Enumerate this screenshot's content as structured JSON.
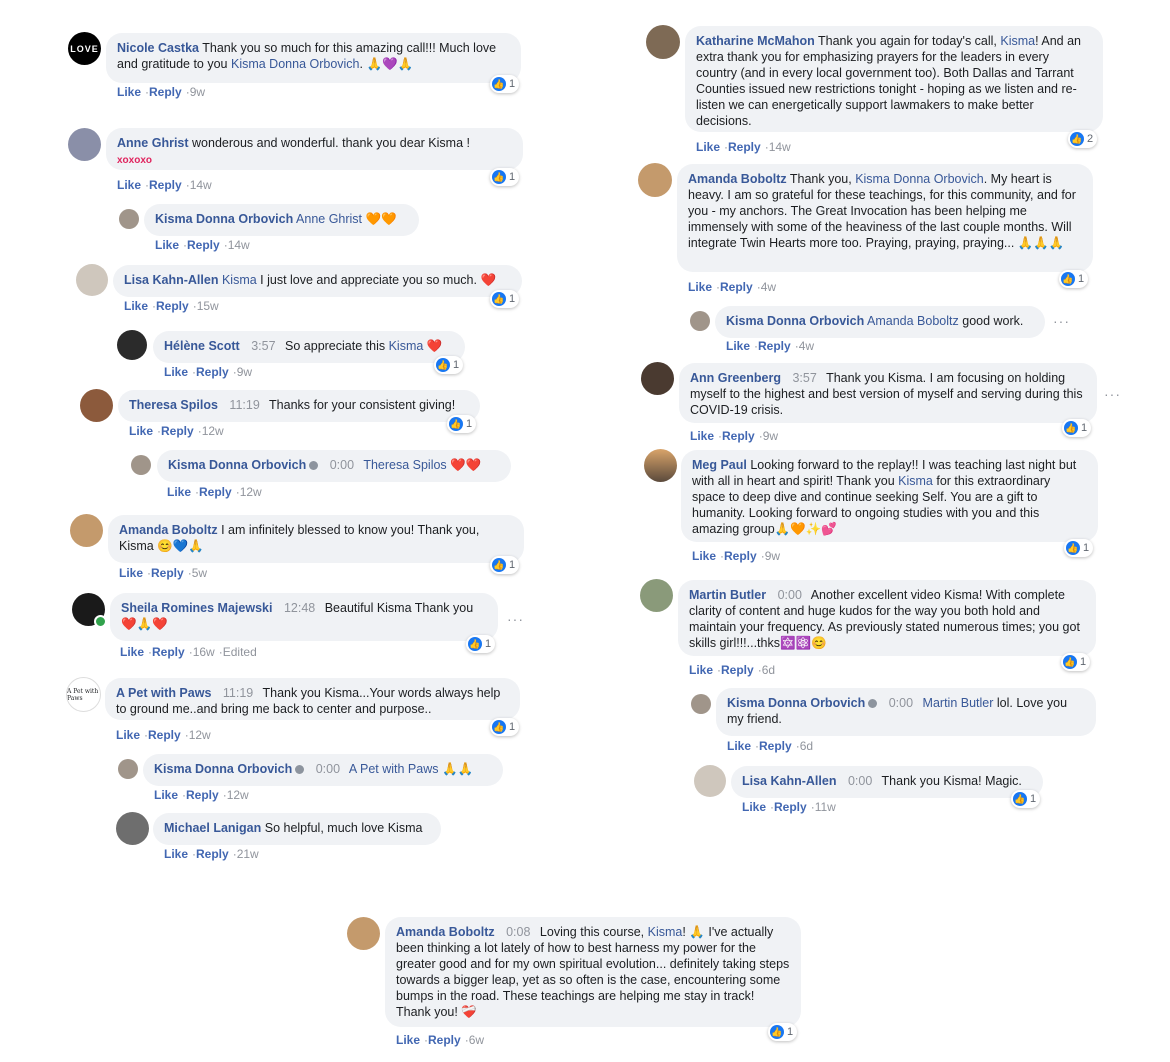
{
  "comments": [
    {
      "id": "c1",
      "name": "Nicole Castka",
      "time": "",
      "pre": "Thank you so much for this amazing call!!! Much love and gratitude to you ",
      "mention": "Kisma Donna Orbovich",
      "post": ".",
      "emoji": "🙏💜🙏",
      "age": "9w",
      "likes": "1"
    },
    {
      "id": "c2",
      "name": "Anne Ghrist",
      "time": "",
      "pre": "wonderous and wonderful. thank you dear Kisma !",
      "mention": "",
      "post": "",
      "extra": "xoxoxo",
      "age": "14w",
      "likes": "1"
    },
    {
      "id": "c3",
      "name": "Kisma Donna Orbovich",
      "time": "",
      "pre": "",
      "mention": "Anne Ghrist",
      "post": "",
      "emoji": "🧡🧡",
      "age": "14w",
      "likes": ""
    },
    {
      "id": "c4",
      "name": "Lisa Kahn-Allen",
      "time": "",
      "pre": "",
      "mention": "Kisma",
      "post": " I just love and appreciate you so much.",
      "emoji": "❤️",
      "age": "15w",
      "likes": "1"
    },
    {
      "id": "c5",
      "name": "Hélène Scott",
      "time": "3:57",
      "pre": "So appreciate this ",
      "mention": "Kisma",
      "post": "",
      "emoji": "❤️",
      "age": "9w",
      "likes": "1"
    },
    {
      "id": "c6",
      "name": "Theresa Spilos",
      "time": "11:19",
      "pre": "Thanks for your consistent giving!",
      "mention": "",
      "post": "",
      "age": "12w",
      "likes": "1"
    },
    {
      "id": "c7",
      "name": "Kisma Donna Orbovich",
      "time": "0:00",
      "pre": "",
      "mention": "Theresa Spilos",
      "post": "",
      "emoji": "❤️❤️",
      "age": "12w",
      "likes": ""
    },
    {
      "id": "c8",
      "name": "Amanda Boboltz",
      "time": "",
      "pre": "I am infinitely blessed to know you! Thank you, Kisma",
      "mention": "",
      "post": "",
      "emoji": "😊💙🙏",
      "age": "5w",
      "likes": "1"
    },
    {
      "id": "c9",
      "name": "Sheila Romines Majewski",
      "time": "12:48",
      "pre": "Beautiful Kisma Thank you",
      "mention": "",
      "post": "",
      "emoji": "❤️🙏❤️",
      "age": "16w",
      "edited": "Edited",
      "likes": "1"
    },
    {
      "id": "c10",
      "name": "A Pet with Paws",
      "time": "11:19",
      "pre": "Thank you Kisma...Your words always help to ground me..and bring me back to center and purpose..",
      "mention": "",
      "post": "",
      "age": "12w",
      "likes": "1"
    },
    {
      "id": "c11",
      "name": "Kisma Donna Orbovich",
      "time": "0:00",
      "pre": "",
      "mention": "A Pet with Paws",
      "post": "",
      "emoji": "🙏🙏",
      "age": "12w",
      "likes": ""
    },
    {
      "id": "c12",
      "name": "Michael Lanigan",
      "time": "",
      "pre": "So helpful, much love Kisma",
      "mention": "",
      "post": "",
      "age": "21w",
      "likes": ""
    },
    {
      "id": "c13",
      "name": "Katharine McMahon",
      "time": "",
      "pre": "Thank you again for today's call, ",
      "mention": "Kisma",
      "post": "! And an extra thank you for emphasizing prayers for the leaders in every country (and in every local government too). Both Dallas and Tarrant Counties issued new restrictions tonight - hoping as we listen and re-listen we can energetically support lawmakers to make better decisions.",
      "age": "14w",
      "likes": "2"
    },
    {
      "id": "c14",
      "name": "Amanda Boboltz",
      "time": "",
      "pre": "Thank you, ",
      "mention": "Kisma Donna Orbovich",
      "post": ". My heart is heavy. I am so grateful for these teachings, for this community, and for you - my anchors. The Great Invocation has been helping me immensely with some of the heaviness of the last couple months. Will integrate Twin Hearts more too. Praying, praying, praying... ",
      "emoji": "🙏🙏🙏",
      "age": "4w",
      "likes": "1"
    },
    {
      "id": "c15",
      "name": "Kisma Donna Orbovich",
      "time": "",
      "pre": "",
      "mention": "Amanda Boboltz",
      "post": " good work.",
      "age": "4w",
      "likes": ""
    },
    {
      "id": "c16",
      "name": "Ann Greenberg",
      "time": "3:57",
      "pre": "Thank you Kisma. I am focusing on holding myself to the highest and best version of myself and serving during this COVID-19 crisis.",
      "mention": "",
      "post": "",
      "age": "9w",
      "likes": "1"
    },
    {
      "id": "c17",
      "name": "Meg Paul",
      "time": "",
      "pre": "Looking forward to the replay!! I was teaching last night but with all in heart and spirit! Thank you ",
      "mention": "Kisma",
      "post": " for this extraordinary space to deep dive and continue seeking Self. You are a gift to humanity. Looking forward to ongoing studies with you and this amazing group",
      "emoji": "🙏🧡✨💕",
      "age": "9w",
      "likes": "1"
    },
    {
      "id": "c18",
      "name": "Martin Butler",
      "time": "0:00",
      "pre": "Another excellent video Kisma! With complete clarity of content and huge kudos for the way you both hold and maintain your frequency. As previously stated numerous times; you got skills girl!!!...thks",
      "mention": "",
      "post": "",
      "emoji": "🔯⚛️😊",
      "age": "6d",
      "likes": "1"
    },
    {
      "id": "c19",
      "name": "Kisma Donna Orbovich",
      "time": "0:00",
      "pre": "",
      "mention": "Martin Butler",
      "post": " lol. Love you my friend.",
      "age": "6d",
      "likes": ""
    },
    {
      "id": "c20",
      "name": "Lisa Kahn-Allen",
      "time": "0:00",
      "pre": "Thank you Kisma! Magic.",
      "mention": "",
      "post": "",
      "age": "11w",
      "likes": "1"
    },
    {
      "id": "c21",
      "name": "Amanda Boboltz",
      "time": "0:08",
      "pre": "Loving this course, ",
      "mention": "Kisma",
      "post": "! 🙏 I've actually been thinking a lot lately of how to best harness my power for the greater good and for my own spiritual evolution... definitely taking steps towards a bigger leap, yet as so often is the case, encountering some bumps in the road. These teachings are helping me stay in track! Thank you! ",
      "emoji": "❤️‍🩹",
      "age": "6w",
      "likes": "1"
    }
  ],
  "actions": {
    "like": "Like",
    "reply": "Reply"
  },
  "avatar_text": {
    "love": "LOVE",
    "paws": "A Pet with Paws"
  },
  "colors": {
    "link": "#385898",
    "action": "#4267b2",
    "bubble": "#f0f2f5",
    "like": "#1877f2"
  }
}
